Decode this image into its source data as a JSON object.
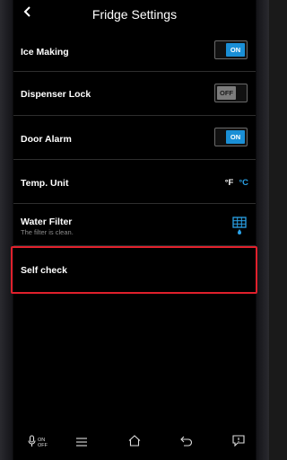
{
  "header": {
    "title": "Fridge Settings",
    "back_icon": "chevron-left-icon"
  },
  "settings": {
    "ice_making": {
      "label": "Ice Making",
      "state": "ON"
    },
    "dispenser_lock": {
      "label": "Dispenser Lock",
      "state": "OFF"
    },
    "door_alarm": {
      "label": "Door Alarm",
      "state": "ON"
    },
    "temp_unit": {
      "label": "Temp. Unit",
      "fahrenheit": "°F",
      "celsius": "°C",
      "selected": "°C"
    },
    "water_filter": {
      "label": "Water Filter",
      "status": "The filter is clean.",
      "icon": "water-filter-icon"
    },
    "self_check": {
      "label": "Self check"
    }
  },
  "navbar": {
    "mic_on": "ON",
    "mic_off": "OFF",
    "icons": [
      "mic-icon",
      "menu-icon",
      "home-icon",
      "back-icon",
      "feedback-icon"
    ]
  },
  "colors": {
    "accent": "#1a8fd6",
    "unit_selected": "#2aa2e8",
    "highlight_border": "#e0202c",
    "background": "#000000"
  }
}
